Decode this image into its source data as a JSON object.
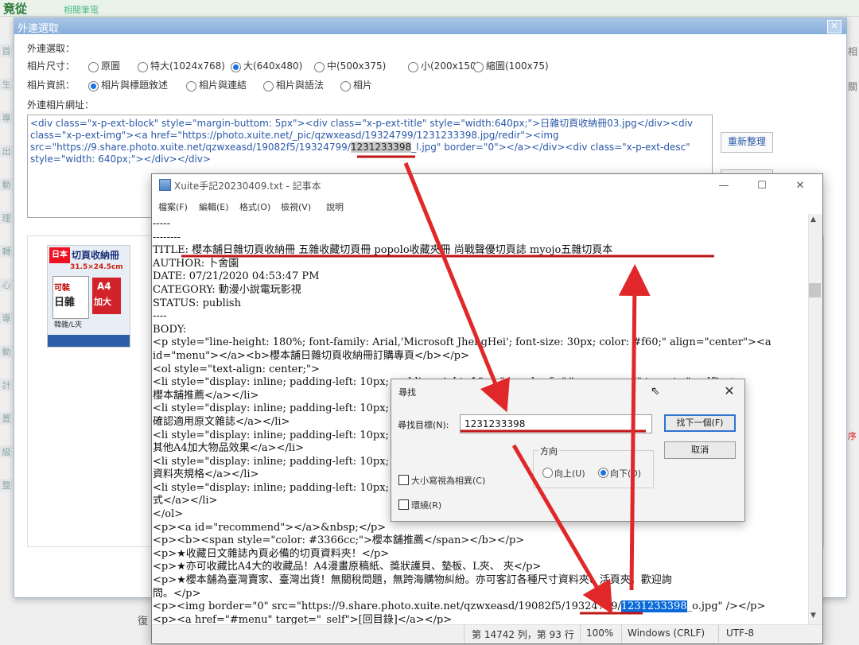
{
  "background": {
    "logo_fragment": "竟從",
    "subtitle_fragment": "相關筆電",
    "side_tabs": [
      "首",
      "生",
      "專",
      "出",
      "動",
      "理",
      "轉",
      "心",
      "專",
      "動",
      "計",
      "置",
      "級",
      "整"
    ],
    "right_fragments": [
      "相",
      "關",
      "序"
    ],
    "bottom_fragment": "復"
  },
  "outer_dialog": {
    "title": "外連選取",
    "close_glyph": "✕",
    "section_label": "外連選取：",
    "size_label": "相片尺寸：",
    "size_options": [
      "原圖",
      "特大(1024x768)",
      "大(640x480)",
      "中(500x375)",
      "小(200x150)",
      "縮圖(100x75)"
    ],
    "size_selected": "大(640x480)",
    "info_label": "相片資訊：",
    "info_options": [
      "相片與標題敘述",
      "相片與連結",
      "相片與語法",
      "相片"
    ],
    "info_selected": "相片與標題敘述",
    "url_label": "外連相片網址：",
    "html_before": "<div class=\"x-p-ext-block\" style=\"margin-buttom: 5px\"><div class=\"x-p-ext-title\" style=\"width:640px;\">日雜切頁收納冊03.jpg</div><div class=\"x-p-ext-img\"><a href=\"https://photo.xuite.net/_pic/qzwxeasd/19324799/1231233398.jpg/redir\"><img src=\"https://9.share.photo.xuite.net/qzwxeasd/19082f5/19324799/",
    "html_highlight": "1231233398",
    "html_after": "_l.jpg\" border=\"0\"></a></div><div class=\"x-p-ext-desc\" style=\"width: 640px;\"></div></div>",
    "refresh_button": "重新整理",
    "thumb": {
      "title": "切頁收納冊",
      "badge": "日本",
      "size_text": "31.5×24.5cm",
      "tags": [
        "可裝",
        "日雜",
        "A4",
        "加大"
      ],
      "footer": "韓雜/L夾"
    }
  },
  "notepad": {
    "title": "Xuite手記20230409.txt - 記事本",
    "menus": [
      "檔案(F)",
      "編輯(E)",
      "格式(O)",
      "檢視(V)",
      "說明"
    ],
    "window_buttons": [
      "—",
      "☐",
      "✕"
    ],
    "lines": [
      "-----",
      "--------",
      "TITLE: 櫻本舖日雜切頁收納冊 五雜收藏切頁冊 popolo收藏夾冊 尚戰聲優切頁誌 myojo五雜切頁本",
      "AUTHOR: 卜舍園",
      "DATE: 07/21/2020 04:53:47 PM",
      "CATEGORY: 動漫小說電玩影視",
      "STATUS: publish",
      "----",
      "BODY:",
      "<p style=\"line-height: 180%; font-family: Arial,'Microsoft JhengHei'; font-size: 30px; color: #f60;\" align=\"center\"><a",
      "id=\"menu\"></a><b>櫻本舖日雜切頁收納冊訂購專頁</b></p>",
      "<ol style=\"text-align: center;\">",
      "<li style=\"display: inline; padding-left: 10px; padding-right: 10px;\"><a href=\"#recommend\" target=\"_self\">★",
      "櫻本舖推薦</a></li>",
      "<li style=\"display: inline; padding-left: 10px; pad                                                 _self\">★已",
      "確認適用原文雜誌</a></li>",
      "<li style=\"display: inline; padding-left: 10px; pad                                                 _self\">★裝",
      "其他A4加大物品效果</a></li>",
      "<li style=\"display: inline; padding-left: 10px; pad                                                f\">★切頁",
      "資料夾規格</a></li>",
      "<li style=\"display: inline; padding-left: 10px; pad                                                \">★訂購方",
      "式</a></li>",
      "</ol>",
      "<p><a id=\"recommend\"></a>&nbsp;</p>",
      "<p><b><span style=\"color: #3366cc;\">櫻本舖推薦</span></b></p>",
      "<p>★收藏日文雜誌內頁必備的切頁資料夾！</p>",
      "<p>★亦可收藏比A4大的收藏品！A4漫畫原稿紙、獎狀護貝、墊板、L夾、 夾</p>",
      "<p>★櫻本舖為臺灣賣家、臺灣出貨！無關稅問題，無跨海購物糾紛。亦可客訂各種尺寸資料夾、活頁夾，歡迎詢",
      "問。</p>"
    ],
    "img_line_before": "<p><img border=\"0\" src=\"https://9.share.photo.xuite.net/qzwxeasd/19082f5/19324799/",
    "img_line_highlight": "1231233398",
    "img_line_after": "_o.jpg\" /></p>",
    "last_line": "<p><a href=\"#menu\" target=\"_self\">[回目錄]</a></p>",
    "status": {
      "position": "第 14742 列，第 93 行",
      "zoom": "100%",
      "line_ending": "Windows (CRLF)",
      "encoding": "UTF-8"
    }
  },
  "find_dialog": {
    "title": "尋找",
    "close_glyph": "✕",
    "target_label": "尋找目標(N):",
    "target_value": "1231233398",
    "find_next_button": "找下一個(F)",
    "cancel_button": "取消",
    "direction_label": "方向",
    "direction_options": [
      "向上(U)",
      "向下(D)"
    ],
    "direction_selected": "向下(D)",
    "match_case_label": "大小寫視為相異(C)",
    "wrap_label": "環繞(R)"
  },
  "colors": {
    "annotation_red": "#e0282a",
    "underline_red": "#c0161a",
    "selection_blue": "#0b6ad8",
    "title_bar_blue": "#86aedb"
  }
}
